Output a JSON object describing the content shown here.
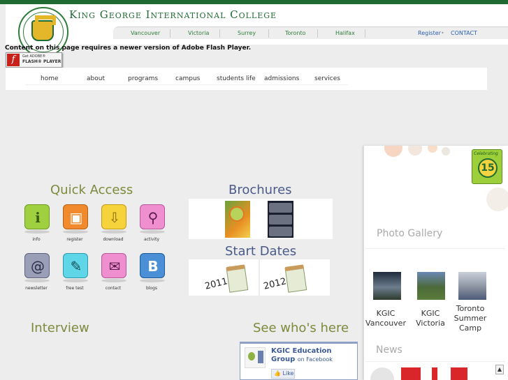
{
  "header": {
    "college_name": "King George International College",
    "cities": [
      "Vancouver",
      "Victoria",
      "Surrey",
      "Toronto",
      "Halifax"
    ],
    "register": "Register",
    "separator": "•",
    "contact": "CONTACT"
  },
  "flash": {
    "message": "Content on this page requires a newer version of Adobe Flash Player.",
    "badge_line1": "Get ADOBE®",
    "badge_line2": "FLASH® PLAYER",
    "badge_glyph": "f"
  },
  "nav": {
    "items": [
      "home",
      "about",
      "programs",
      "campus",
      "students life",
      "admissions",
      "services"
    ]
  },
  "quick_access": {
    "title": "Quick Access",
    "items": [
      {
        "label": "info",
        "icon": "info-icon",
        "color": "#9fd03f"
      },
      {
        "label": "register",
        "icon": "floppy-disk-icon",
        "color": "#f08a2c"
      },
      {
        "label": "download",
        "icon": "download-arrow-icon",
        "color": "#f6d33b"
      },
      {
        "label": "activity",
        "icon": "activity-figure-icon",
        "color": "#ef8fcf"
      },
      {
        "label": "newsletter",
        "icon": "rss-email-icon",
        "color": "#9a9fb7"
      },
      {
        "label": "free test",
        "icon": "pencil-pad-icon",
        "color": "#5fd6e8"
      },
      {
        "label": "contact",
        "icon": "envelope-icon",
        "color": "#ef8fcf"
      },
      {
        "label": "blogs",
        "icon": "blog-icon",
        "color": "#4b8fd6"
      }
    ]
  },
  "brochures": {
    "title": "Brochures"
  },
  "start_dates": {
    "title": "Start Dates",
    "years": [
      "2011",
      "2012"
    ]
  },
  "interview": {
    "title": "Interview"
  },
  "social": {
    "title": "See who's here",
    "fb_name": "KGIC Education Group",
    "fb_on": "on Facebook",
    "fb_like": "Like"
  },
  "side": {
    "badge_text": "Celebrating",
    "badge_number": "15",
    "gallery_title": "Photo Gallery",
    "gallery": [
      {
        "caption": "KGIC Vancouver"
      },
      {
        "caption": "KGIC Victoria"
      },
      {
        "caption": "Toronto Summer Camp"
      }
    ],
    "news_title": "News",
    "scroll_up": "▲"
  },
  "colors": {
    "brand_green": "#1f6b33",
    "accent_olive": "#7c8a3c"
  }
}
